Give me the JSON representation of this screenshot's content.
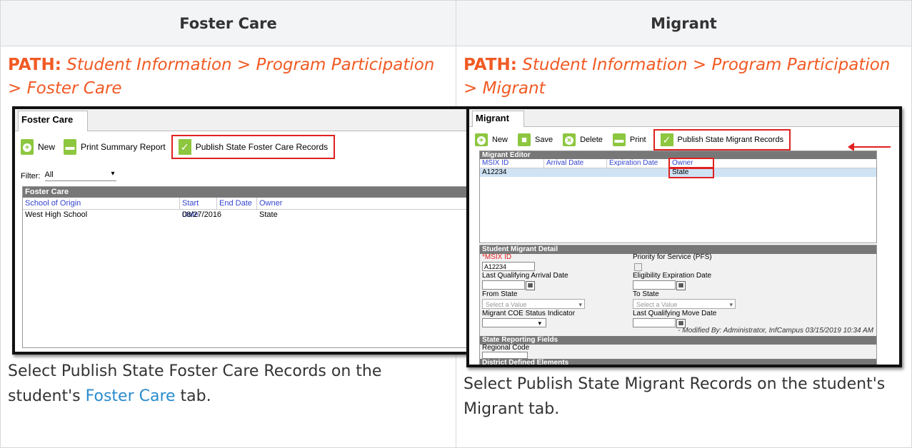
{
  "header": {
    "col1": "Foster Care",
    "col2": "Migrant"
  },
  "foster": {
    "path_label": "PATH:",
    "path_text": " Student Information > Program Participation > Foster Care",
    "caption_pre": "Select Publish State Foster Care Records on the student's ",
    "caption_link": "Foster Care",
    "caption_post": " tab.",
    "shot": {
      "tab": "Foster Care",
      "toolbar": [
        "New",
        "Print Summary Report",
        "Publish State Foster Care Records"
      ],
      "filter_label": "Filter:",
      "filter_value": "All",
      "grid_title": "Foster Care",
      "columns": [
        "School of Origin",
        "Start Date",
        "End Date",
        "Owner"
      ],
      "rows": [
        [
          "West High School",
          "08/27/2016",
          "",
          "State"
        ]
      ]
    }
  },
  "migrant": {
    "path_label": "PATH:",
    "path_text": " Student Information > Program Participation > Migrant",
    "caption": "Select Publish State Migrant Records on the student's Migrant tab.",
    "shot": {
      "tab": "Migrant",
      "toolbar": [
        "New",
        "Save",
        "Delete",
        "Print",
        "Publish State Migrant Records"
      ],
      "grid_title": "Migrant Editor",
      "columns": [
        "MSIX ID",
        "Arrival Date",
        "Expiration Date",
        "Owner"
      ],
      "rows": [
        [
          "A12234",
          "",
          "",
          "State"
        ]
      ],
      "detail_title": "Student Migrant Detail",
      "msix_label": "*MSIX ID",
      "msix_value": "A12234",
      "pfs_label": "Priority for Service (PFS)",
      "arrival_label": "Last Qualifying Arrival Date",
      "eligibility_label": "Eligibility Expiration Date",
      "from_state_label": "From State",
      "to_state_label": "To State",
      "select_placeholder": "Select a Value",
      "coe_label": "Migrant COE Status Indicator",
      "move_label": "Last Qualifying Move Date",
      "modified": "- Modified By: Administrator, InfCampus 03/15/2019 10:34 AM",
      "state_fields_title": "State Reporting Fields",
      "regional_label": "Regional Code",
      "district_title": "District Defined Elements"
    }
  }
}
